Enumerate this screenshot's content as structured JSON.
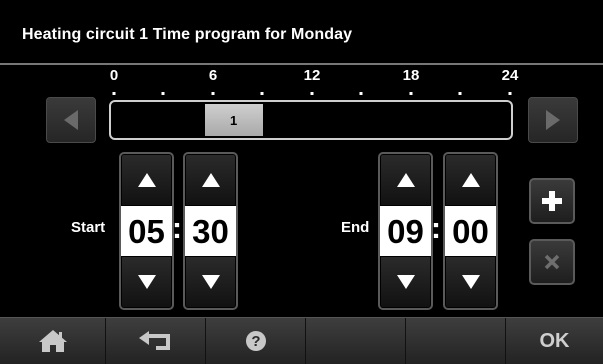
{
  "header": {
    "title": "Heating circuit 1 Time program for Monday"
  },
  "timeline": {
    "ticks": [
      "0",
      "6",
      "12",
      "18",
      "24"
    ],
    "segment": {
      "label": "1",
      "start_hour": 5.5,
      "end_hour": 9.0
    }
  },
  "start": {
    "label": "Start",
    "hour": "05",
    "minute": "30",
    "separator": ":"
  },
  "end": {
    "label": "End",
    "hour": "09",
    "minute": "00",
    "separator": ":"
  },
  "bottom_bar": {
    "ok_label": "OK"
  },
  "icons": {
    "prev": "left-arrow-icon",
    "next": "right-arrow-icon",
    "home": "home-icon",
    "back": "back-arrow-icon",
    "help": "help-icon",
    "add": "plus-icon",
    "delete": "close-icon"
  }
}
